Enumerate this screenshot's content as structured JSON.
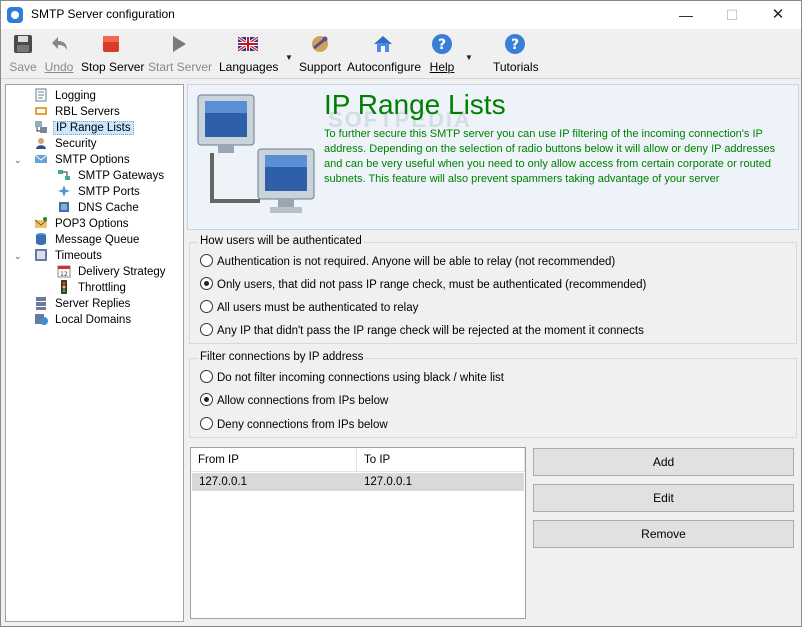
{
  "window": {
    "title": "SMTP Server configuration",
    "minimize": "—",
    "maximize": "☐",
    "close": "✕"
  },
  "toolbar": {
    "save": "Save",
    "undo": "Undo",
    "stop_server": "Stop Server",
    "start_server": "Start Server",
    "languages": "Languages",
    "support": "Support",
    "autoconfigure": "Autoconfigure",
    "help": "Help",
    "tutorials": "Tutorials"
  },
  "tree": {
    "logging": "Logging",
    "rbl_servers": "RBL Servers",
    "ip_range_lists": "IP Range Lists",
    "security": "Security",
    "smtp_options": "SMTP Options",
    "smtp_gateways": "SMTP Gateways",
    "smtp_ports": "SMTP Ports",
    "dns_cache": "DNS Cache",
    "pop3_options": "POP3 Options",
    "message_queue": "Message Queue",
    "timeouts": "Timeouts",
    "delivery_strategy": "Delivery Strategy",
    "throttling": "Throttling",
    "server_replies": "Server Replies",
    "local_domains": "Local Domains",
    "selected": "IP Range Lists"
  },
  "header": {
    "title": "IP Range Lists",
    "description": "To further secure this SMTP server you can use IP filtering of the incoming connection's IP address. Depending on the selection of radio buttons below it will allow or deny IP addresses and can be very useful when you need to only allow access from certain corporate or routed subnets. This feature will also prevent spammers taking advantage of your server",
    "watermark": "SOFTPEDIA"
  },
  "auth_group": {
    "title": "How users will be authenticated",
    "options": [
      "Authentication is not required. Anyone will be able to relay (not recommended)",
      "Only users, that did not pass IP range check, must be authenticated (recommended)",
      "All users must be authenticated to relay",
      "Any IP that didn't pass the IP range check will be rejected at the moment it connects"
    ],
    "selected_index": 1
  },
  "filter_group": {
    "title": "Filter connections by IP address",
    "options": [
      "Do not filter incoming connections using black / white list",
      "Allow connections from IPs below",
      "Deny connections from IPs below"
    ],
    "selected_index": 1
  },
  "ip_list": {
    "columns": [
      "From IP",
      "To IP"
    ],
    "rows": [
      {
        "from": "127.0.0.1",
        "to": "127.0.0.1"
      }
    ]
  },
  "buttons": {
    "add": "Add",
    "edit": "Edit",
    "remove": "Remove"
  }
}
